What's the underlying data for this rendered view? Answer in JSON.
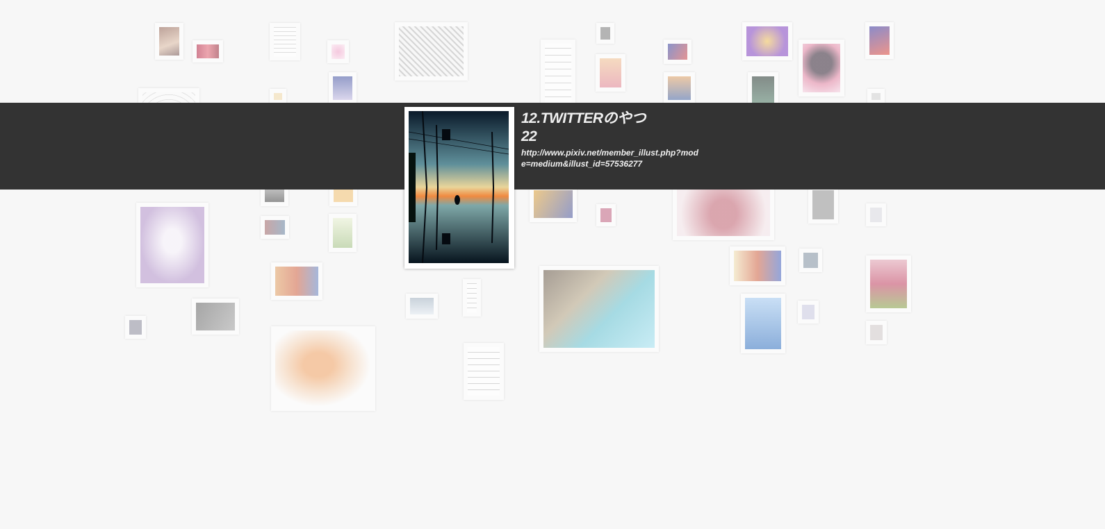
{
  "detail": {
    "title": "12.TWITTERのやつ22",
    "link": "http://www.pixiv.net/member_illust.php?mode=medium&illust_id=57536277"
  },
  "colors": {
    "background": "#f7f7f7",
    "overlay_band": "#333333",
    "text": "#f0f0f0"
  },
  "thumbnails": [
    {
      "name": "thumb-01",
      "art": "portrait-warm"
    },
    {
      "name": "thumb-02",
      "art": "red-scene"
    },
    {
      "name": "thumb-03",
      "art": "manga-page"
    },
    {
      "name": "thumb-04",
      "art": "pink-sketch"
    },
    {
      "name": "thumb-05",
      "art": "lineart-wide"
    },
    {
      "name": "thumb-06",
      "art": "manga-strip"
    },
    {
      "name": "thumb-07",
      "art": "small-gray"
    },
    {
      "name": "thumb-08",
      "art": "pink-girl"
    },
    {
      "name": "thumb-09",
      "art": "blue-red"
    },
    {
      "name": "thumb-10",
      "art": "purple-glow"
    },
    {
      "name": "thumb-11",
      "art": "dark-figure"
    },
    {
      "name": "thumb-12",
      "art": "red-hat-girl"
    },
    {
      "name": "thumb-13",
      "art": "blue-night"
    },
    {
      "name": "thumb-14",
      "art": "lavender-girl"
    },
    {
      "name": "thumb-15",
      "art": "kimono-girl"
    },
    {
      "name": "thumb-16",
      "art": "city-pool"
    },
    {
      "name": "thumb-17",
      "art": "orange-fairy"
    },
    {
      "name": "thumb-18",
      "art": "manga-tall"
    }
  ]
}
